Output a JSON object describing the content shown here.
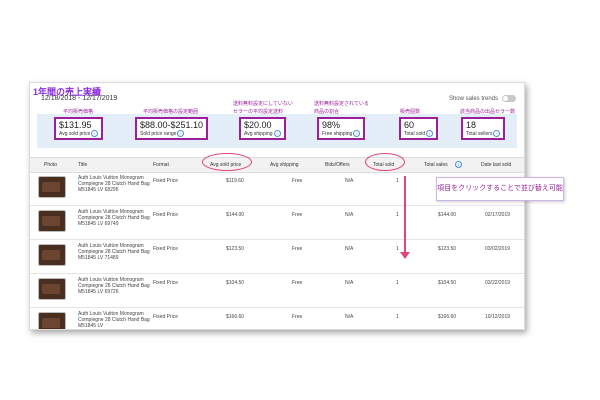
{
  "header": {
    "jp_title": "1年間の売上実績",
    "date_range": "12/18/2018 - 12/17/2019",
    "sales_trends_label": "Show sales trends"
  },
  "stats": [
    {
      "value": "$131.95",
      "label": "Avg sold price",
      "annotation": "平均販売価格"
    },
    {
      "value": "$88.00-$251.10",
      "label": "Sold price range",
      "annotation": "平均販売価格の設定範囲"
    },
    {
      "value": "$20.00",
      "label": "Avg shipping",
      "annotation1": "送料無料設定にしていない",
      "annotation2": "セラーの平均設定送料"
    },
    {
      "value": "98%",
      "label": "Free shipping",
      "annotation1": "送料無料設定されている",
      "annotation2": "商品の割合"
    },
    {
      "value": "60",
      "label": "Total sold",
      "annotation": "販売個数"
    },
    {
      "value": "18",
      "label": "Total sellers",
      "annotation": "該当商品の出品セラー数"
    }
  ],
  "table": {
    "columns": [
      "Photo",
      "Title",
      "Format",
      "Avg sold price",
      "Avg shipping",
      "Bids/Offers",
      "Total sold",
      "Total sales",
      "Date last sold"
    ],
    "rows": [
      {
        "title": "Auth Louis Vuitton Monogram Compiegne 28 Clutch Hand Bag M51845 LV 68295",
        "format": "Fixed Price",
        "avg_price": "$119.60",
        "shipping": "Free",
        "bids": "N/A",
        "sold": "1",
        "sales": "",
        "date": ""
      },
      {
        "title": "Auth Louis Vuitton Monogram Compiegne 28 Clutch Hand Bag M51845 LV 69749",
        "format": "Fixed Price",
        "avg_price": "$144.00",
        "shipping": "Free",
        "bids": "N/A",
        "sold": "1",
        "sales": "$144.00",
        "date": "02/17/2019"
      },
      {
        "title": "Auth Louis Vuitton Monogram Compiegne 28 Clutch Hand Bag M51845 LV 71489",
        "format": "Fixed Price",
        "avg_price": "$123.50",
        "shipping": "Free",
        "bids": "N/A",
        "sold": "1",
        "sales": "$123.50",
        "date": "03/02/2019"
      },
      {
        "title": "Auth Louis Vuitton Monogram Compiegne 28 Clutch Hand Bag M51845 LV 69726",
        "format": "Fixed Price",
        "avg_price": "$104.50",
        "shipping": "Free",
        "bids": "N/A",
        "sold": "1",
        "sales": "$104.50",
        "date": "03/22/2019"
      },
      {
        "title": "Auth Louis Vuitton Monogram Compiegne 28 Clutch Hand Bag M51845 LV",
        "format": "Fixed Price",
        "avg_price": "$166.60",
        "shipping": "Free",
        "bids": "N/A",
        "sold": "1",
        "sales": "$166.60",
        "date": "10/12/2019"
      }
    ]
  },
  "callout": "項目をクリックすることで並び替え可能",
  "colors": {
    "annotation": "#9b1f98",
    "highlight": "#e0457b",
    "stats_bg": "#e3eef8"
  }
}
